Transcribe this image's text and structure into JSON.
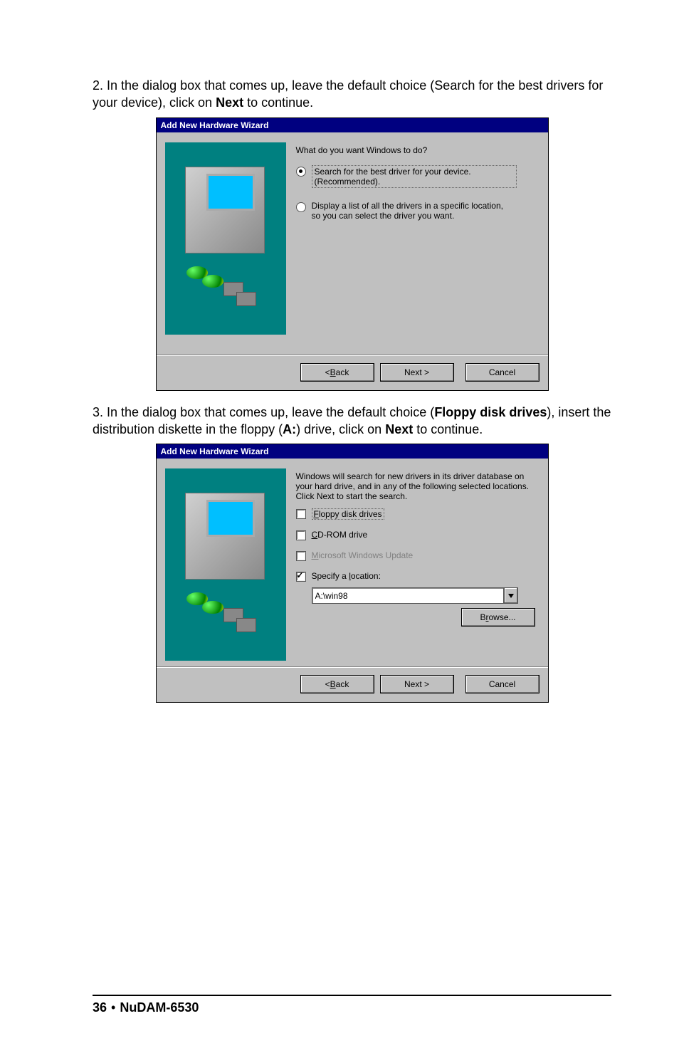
{
  "step2": {
    "text_a": "2. In the dialog box that comes up, leave the default choice (Search for the best drivers for your device), click on ",
    "text_b": "Next",
    "text_c": " to continue."
  },
  "step3": {
    "text_a": "3. In the dialog box that comes up, leave the default choice (",
    "text_b": "Floppy disk drives",
    "text_c": "), insert the distribution diskette in the floppy (",
    "text_d": "A:",
    "text_e": ") drive, click on ",
    "text_f": "Next",
    "text_g": " to continue."
  },
  "dialog1": {
    "title": "Add New Hardware Wizard",
    "prompt": "What do you want Windows to do?",
    "radio1": "Search for the best driver for your device. (Recommended).",
    "radio2": "Display a list of all the drivers in a specific location, so you can select the driver you want.",
    "back": "ack",
    "back_prefix": "< ",
    "back_u": "B",
    "next": "Next >",
    "cancel": "Cancel"
  },
  "dialog2": {
    "title": "Add New Hardware Wizard",
    "prompt": "Windows will search for new drivers in its driver database on your hard drive, and in any of the following selected locations. Click Next to start the search.",
    "chk_floppy_u": "F",
    "chk_floppy": "loppy disk drives",
    "chk_cd_u": "C",
    "chk_cd": "D-ROM drive",
    "chk_msu_u": "M",
    "chk_msu": "icrosoft Windows Update",
    "chk_loc_prefix": "Specify a ",
    "chk_loc_u": "l",
    "chk_loc_suffix": "ocation:",
    "location_value": "A:\\win98",
    "browse_prefix": "B",
    "browse_u": "r",
    "browse_suffix": "owse...",
    "back": "ack",
    "back_prefix": "< ",
    "back_u": "B",
    "next": "Next >",
    "cancel": "Cancel"
  },
  "footer": {
    "page": "36",
    "bullet": "•",
    "product": "NuDAM-6530"
  }
}
